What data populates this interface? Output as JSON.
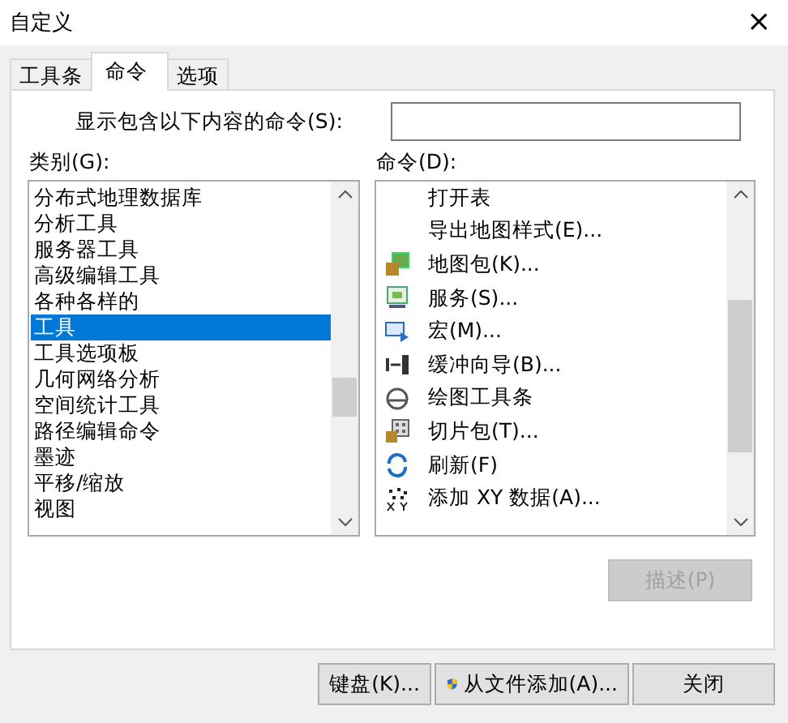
{
  "window": {
    "title": "自定义",
    "close": "×"
  },
  "tabs": [
    {
      "label": "工具条",
      "selected": false
    },
    {
      "label": "命令",
      "selected": true
    },
    {
      "label": "选项",
      "selected": false
    }
  ],
  "search": {
    "label": "显示包含以下内容的命令(S):"
  },
  "categories": {
    "label": "类别(G):",
    "items": [
      {
        "label": "分布式地理数据库",
        "selected": false
      },
      {
        "label": "分析工具",
        "selected": false
      },
      {
        "label": "服务器工具",
        "selected": false
      },
      {
        "label": "高级编辑工具",
        "selected": false
      },
      {
        "label": "各种各样的",
        "selected": false
      },
      {
        "label": "工具",
        "selected": true
      },
      {
        "label": "工具选项板",
        "selected": false
      },
      {
        "label": "几何网络分析",
        "selected": false
      },
      {
        "label": "空间统计工具",
        "selected": false
      },
      {
        "label": "路径编辑命令",
        "selected": false
      },
      {
        "label": "墨迹",
        "selected": false
      },
      {
        "label": "平移/缩放",
        "selected": false
      },
      {
        "label": "视图",
        "selected": false
      }
    ]
  },
  "commands": {
    "label": "命令(D):",
    "items": [
      {
        "label": "打开表"
      },
      {
        "label": "导出地图样式(E)..."
      },
      {
        "label": "地图包(K)..."
      },
      {
        "label": "服务(S)..."
      },
      {
        "label": "宏(M)..."
      },
      {
        "label": "缓冲向导(B)..."
      },
      {
        "label": "绘图工具条"
      },
      {
        "label": "切片包(T)..."
      },
      {
        "label": "刷新(F)"
      },
      {
        "label": "添加 XY 数据(A)..."
      }
    ]
  },
  "describe_button": {
    "label": "描述(P)",
    "disabled": true
  },
  "buttons": [
    {
      "label": "键盘(K)...",
      "kind": "plain"
    },
    {
      "label": "从文件添加(A)...",
      "kind": "shield"
    },
    {
      "label": "关闭",
      "kind": "plain"
    }
  ]
}
